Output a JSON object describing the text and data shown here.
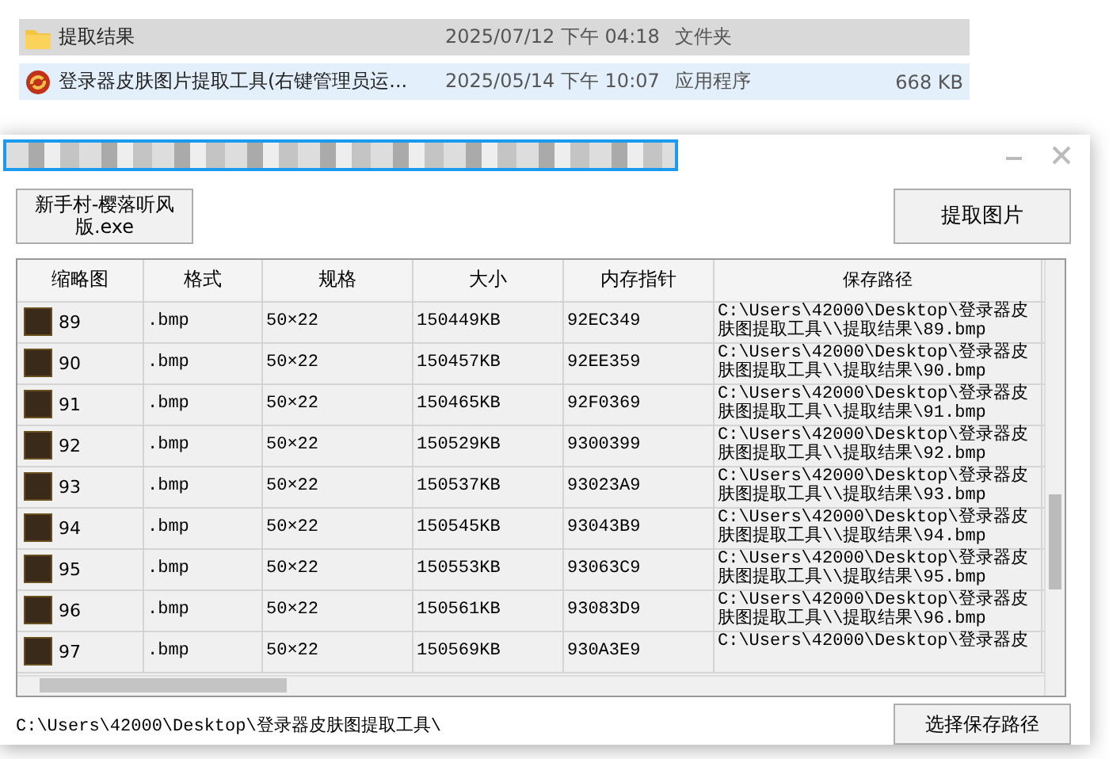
{
  "explorer": {
    "files": [
      {
        "kind": "folder",
        "name": "提取结果",
        "date": "2025/07/12 下午 04:18",
        "type": "文件夹",
        "selected": true
      },
      {
        "kind": "app",
        "name": "登录器皮肤图片提取工具(右键管理员运...",
        "date": "2025/05/14 下午 10:07",
        "type": "应用程序",
        "size": "668 KB",
        "selected": false
      }
    ]
  },
  "dialog": {
    "target_button": "新手村-樱落听风版.exe",
    "extract_button": "提取图片",
    "table": {
      "columns": [
        "缩略图",
        "格式",
        "规格",
        "大小",
        "内存指针",
        "保存路径"
      ],
      "rows": [
        {
          "index": "89",
          "format": ".bmp",
          "spec": "50×22",
          "size": "150449KB",
          "pointer": "92EC349",
          "path": "C:\\Users\\42000\\Desktop\\登录器皮肤图提取工具\\\\提取结果\\89.bmp"
        },
        {
          "index": "90",
          "format": ".bmp",
          "spec": "50×22",
          "size": "150457KB",
          "pointer": "92EE359",
          "path": "C:\\Users\\42000\\Desktop\\登录器皮肤图提取工具\\\\提取结果\\90.bmp"
        },
        {
          "index": "91",
          "format": ".bmp",
          "spec": "50×22",
          "size": "150465KB",
          "pointer": "92F0369",
          "path": "C:\\Users\\42000\\Desktop\\登录器皮肤图提取工具\\\\提取结果\\91.bmp"
        },
        {
          "index": "92",
          "format": ".bmp",
          "spec": "50×22",
          "size": "150529KB",
          "pointer": "9300399",
          "path": "C:\\Users\\42000\\Desktop\\登录器皮肤图提取工具\\\\提取结果\\92.bmp"
        },
        {
          "index": "93",
          "format": ".bmp",
          "spec": "50×22",
          "size": "150537KB",
          "pointer": "93023A9",
          "path": "C:\\Users\\42000\\Desktop\\登录器皮肤图提取工具\\\\提取结果\\93.bmp"
        },
        {
          "index": "94",
          "format": ".bmp",
          "spec": "50×22",
          "size": "150545KB",
          "pointer": "93043B9",
          "path": "C:\\Users\\42000\\Desktop\\登录器皮肤图提取工具\\\\提取结果\\94.bmp"
        },
        {
          "index": "95",
          "format": ".bmp",
          "spec": "50×22",
          "size": "150553KB",
          "pointer": "93063C9",
          "path": "C:\\Users\\42000\\Desktop\\登录器皮肤图提取工具\\\\提取结果\\95.bmp"
        },
        {
          "index": "96",
          "format": ".bmp",
          "spec": "50×22",
          "size": "150561KB",
          "pointer": "93083D9",
          "path": "C:\\Users\\42000\\Desktop\\登录器皮肤图提取工具\\\\提取结果\\96.bmp"
        },
        {
          "index": "97",
          "format": ".bmp",
          "spec": "50×22",
          "size": "150569KB",
          "pointer": "930A3E9",
          "path": "C:\\Users\\42000\\Desktop\\登录器皮"
        }
      ]
    },
    "save_path": "C:\\Users\\42000\\Desktop\\登录器皮肤图提取工具\\",
    "choose_path_button": "选择保存路径"
  }
}
